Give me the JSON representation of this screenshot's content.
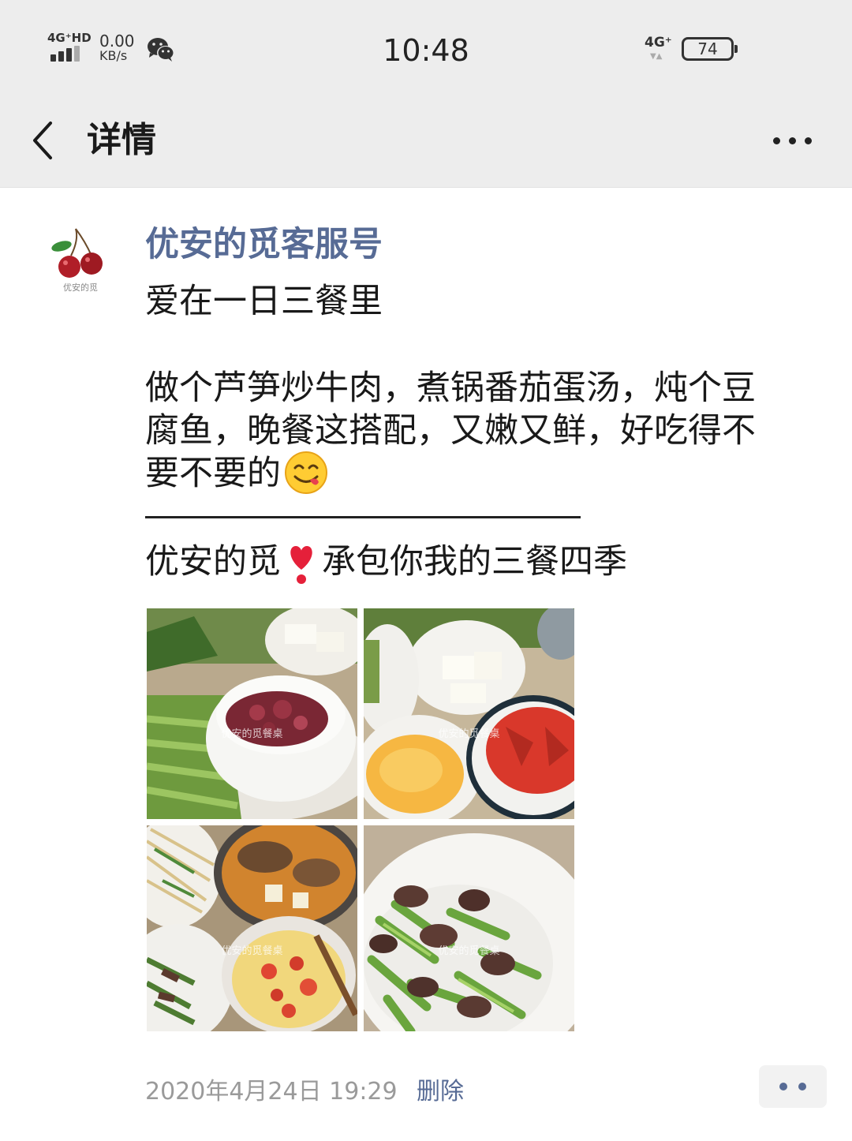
{
  "status_bar": {
    "network": "4G⁺HD",
    "speed_value": "0.00",
    "speed_unit": "KB/s",
    "time": "10:48",
    "network_right": "4G⁺",
    "battery": "74"
  },
  "nav": {
    "title": "详情"
  },
  "post": {
    "author": "优安的觅客服号",
    "avatar_caption": "优安的觅",
    "line1": "爱在一日三餐里",
    "line2": "做个芦笋炒牛肉，煮锅番茄蛋汤，炖个豆",
    "line3": "腐鱼，晚餐这搭配，又嫩又鲜，好吃得不",
    "line4": "要不要的",
    "slogan_part1": "优安的觅",
    "slogan_part2": "承包你我的三餐四季",
    "photo_watermark": "优安的觅餐桌",
    "date": "2020年4月24日 19:29",
    "delete_label": "删除"
  },
  "icons": {
    "back": "chevron-left-icon",
    "more": "more-dots-icon",
    "emoji": "yum-face-emoji",
    "heart": "heart-exclamation-emoji",
    "comment": "comment-dots-icon"
  },
  "colors": {
    "link": "#576b95",
    "bar_bg": "#ededed",
    "meta_gray": "#9a9a9a"
  }
}
